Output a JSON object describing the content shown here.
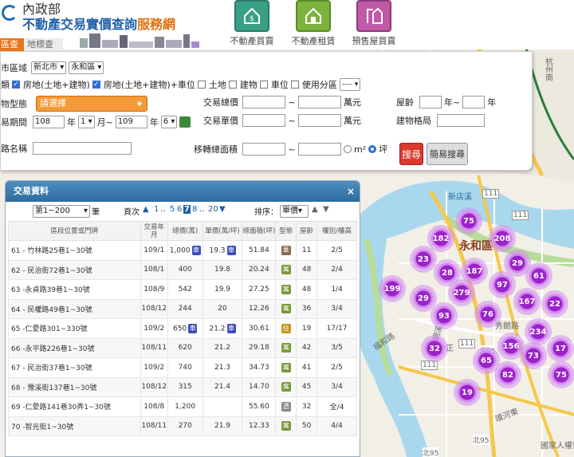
{
  "header": {
    "ministry": "內政部",
    "title_main": "不動產交易實價查詢",
    "title_accent": "服務網",
    "tabs": [
      {
        "label": "不動產買賣",
        "color": "#3aa085"
      },
      {
        "label": "不動產租賃",
        "color": "#7cb33c"
      },
      {
        "label": "預售屋買賣",
        "color": "#c05aa8"
      }
    ],
    "subtabs": [
      "區查詢",
      "地標查詢"
    ]
  },
  "search": {
    "city_label": "市區域",
    "city": "新北市",
    "district": "永和區",
    "type_label": "類",
    "types": [
      {
        "label": "房地(土地+建物)",
        "checked": true
      },
      {
        "label": "房地(土地+建物)+車位",
        "checked": true
      },
      {
        "label": "土地",
        "checked": false
      },
      {
        "label": "建物",
        "checked": false
      },
      {
        "label": "車位",
        "checked": false
      },
      {
        "label": "使用分區",
        "checked": false
      }
    ],
    "zoning": "----",
    "building_type_label": "物型態",
    "building_type": "請選擇",
    "price_label": "交易總價",
    "price_unit": "萬元",
    "unit_price_label": "交易單價",
    "unit_price_unit": "萬元",
    "age_label": "屋齡",
    "age_unit": "年",
    "age_sep": "年~",
    "period_label": "易期間",
    "from_year": "108",
    "year_lbl": "年",
    "from_month": "1",
    "month_lbl": "月~",
    "to_year": "109",
    "to_month": "6",
    "layout_label": "建物格局",
    "road_label": "路名稱",
    "area_label": "移轉總面積",
    "area_unit_m2": "m²",
    "area_unit_ping": "坪",
    "tilde": "~",
    "search_btn": "搜尋",
    "simple_btn": "簡易搜尋"
  },
  "results": {
    "title": "交易資料",
    "close": "×",
    "range": "第1~200",
    "range_suffix": "筆",
    "page_label": "頁次",
    "pages": [
      "1",
      "..",
      "5",
      "6",
      "7",
      "8",
      "..",
      "20"
    ],
    "current_page": "7",
    "sort_label": "排序：",
    "sort": "單價",
    "columns": [
      "區段位置或門牌",
      "交易年月",
      "總價(萬)",
      "單價(萬/坪)",
      "總面積(坪)",
      "型態",
      "屋齡",
      "樓別/樓高"
    ],
    "rows": [
      {
        "addr": "61 - 竹林路25巷1~30號",
        "date": "109/1",
        "total": "1,000",
        "car_total": true,
        "unit": "19.3",
        "car_unit": true,
        "area": "51.84",
        "type": "華",
        "type_color": "#8a6a4a",
        "age": "11",
        "floor": "2/5"
      },
      {
        "addr": "62 - 民治街72巷1~30號",
        "date": "108/1",
        "total": "400",
        "car_total": false,
        "unit": "19.8",
        "car_unit": false,
        "area": "20.24",
        "type": "寓",
        "type_color": "#7a9a3a",
        "age": "48",
        "floor": "2/4"
      },
      {
        "addr": "63 -永貞路39巷1~30號",
        "date": "108/9",
        "total": "542",
        "car_total": false,
        "unit": "19.9",
        "car_unit": false,
        "area": "27.25",
        "type": "寓",
        "type_color": "#7a9a3a",
        "age": "48",
        "floor": "1/4"
      },
      {
        "addr": "64 - 民權路49巷1~30號",
        "date": "108/12",
        "total": "244",
        "car_total": false,
        "unit": "20",
        "car_unit": false,
        "area": "12.26",
        "type": "寓",
        "type_color": "#7a9a3a",
        "age": "36",
        "floor": "3/4"
      },
      {
        "addr": "65 -仁愛路301~330號",
        "date": "109/2",
        "total": "650",
        "car_total": true,
        "unit": "21.2",
        "car_unit": true,
        "area": "30.61",
        "type": "住",
        "type_color": "#c7951a",
        "age": "19",
        "floor": "17/17"
      },
      {
        "addr": "66 -永平路226巷1~30號",
        "date": "108/11",
        "total": "620",
        "car_total": false,
        "unit": "21.2",
        "car_unit": false,
        "area": "29.18",
        "type": "寓",
        "type_color": "#7a9a3a",
        "age": "42",
        "floor": "3/5"
      },
      {
        "addr": "67 - 民治街37巷1~30號",
        "date": "109/2",
        "total": "740",
        "car_total": false,
        "unit": "21.3",
        "car_unit": false,
        "area": "34.73",
        "type": "寓",
        "type_color": "#7a9a3a",
        "age": "41",
        "floor": "2/5"
      },
      {
        "addr": "68 - 豫溪街137巷1~30號",
        "date": "108/12",
        "total": "315",
        "car_total": false,
        "unit": "21.4",
        "car_unit": false,
        "area": "14.70",
        "type": "寓",
        "type_color": "#7a9a3a",
        "age": "45",
        "floor": "3/4"
      },
      {
        "addr": "69 -仁愛路141巷30弄1~30號",
        "date": "108/8",
        "total": "1,200",
        "car_total": false,
        "unit": "",
        "car_unit": false,
        "area": "55.60",
        "type": "透",
        "type_color": "#888888",
        "age": "32",
        "floor": "全/4"
      },
      {
        "addr": "70 -智光街1~30號",
        "date": "108/11",
        "total": "270",
        "car_total": false,
        "unit": "21.9",
        "car_unit": false,
        "area": "12.33",
        "type": "寓",
        "type_color": "#7a9a3a",
        "age": "50",
        "floor": "4/4"
      }
    ],
    "car_tag": "車"
  },
  "map": {
    "district_label": "永和區",
    "labels": [
      "杭州南",
      "新店溪",
      "網溪路",
      "中正",
      "秀朗路",
      "環河東",
      "福和路",
      "北95",
      "北95",
      "北95",
      "國家人權博",
      "111",
      "111",
      "111",
      "111"
    ],
    "clusters": [
      "75",
      "182",
      "208",
      "23",
      "28",
      "187",
      "29",
      "61",
      "199",
      "29",
      "279",
      "97",
      "167",
      "22",
      "93",
      "76",
      "234",
      "32",
      "156",
      "73",
      "17",
      "65",
      "82",
      "75",
      "19"
    ]
  }
}
